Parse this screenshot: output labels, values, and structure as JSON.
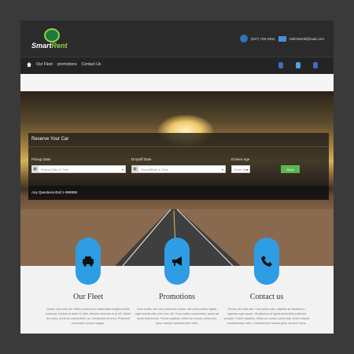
{
  "header": {
    "logo_text_main": "Smart",
    "logo_text_accent": "Rent",
    "phone": "(647) 739-3462",
    "email": "HelloWorld@mail.com"
  },
  "nav": {
    "items": [
      {
        "label": "Our Fleet"
      },
      {
        "label": "promotions"
      },
      {
        "label": "Contact Us"
      }
    ],
    "social": [
      "facebook-icon",
      "twitter-icon",
      "google-plus-icon"
    ]
  },
  "reserve": {
    "title": "Reserve Your Car",
    "pickup_label": "Pickup Date",
    "pickup_placeholder": "Pickup Date & Time",
    "dropoff_label": "Dropoff Date",
    "dropoff_placeholder": "DropoffDate & Time",
    "age_label": "Drivers Age",
    "age_value": "Driver Age",
    "search_label": "Book",
    "questions_label": "Any Questions ?",
    "call_label": "Call 1-999999"
  },
  "features": [
    {
      "icon": "car-icon",
      "title": "Our Fleet",
      "text": "Donec sed odio dui. Etiam porta sem malesuada magna mollis euismod. Nullam id dolor id nibh ultricies vehicula ut id elit. Morbi leo risus, porta ac consectetur ac, vestibulum at eros. Praesent commodo cursus magna."
    },
    {
      "icon": "megaphone-icon",
      "title": "Promotions",
      "text": "Duis mollis, est non commodo luctus, nisi erat porttitor ligula, eget lacinia odio sem nec elit. Cras mattis consectetur purus sit amet fermentum. Fusce dapibus, tellus ac cursus commodo, tortor mauris condimentum nibh."
    },
    {
      "icon": "phone-icon",
      "title": "Contact us",
      "text": "Donec sed odio dui. Cras justo odio, dapibus ac facilisis in, egestas eget quam. Vestibulum id ligula porta felis euismod semper. Fusce dapibus, tellus ac cursus commodo, tortor mauris condimentum nibh, ut fermentum massa justo sit amet risus."
    }
  ]
}
